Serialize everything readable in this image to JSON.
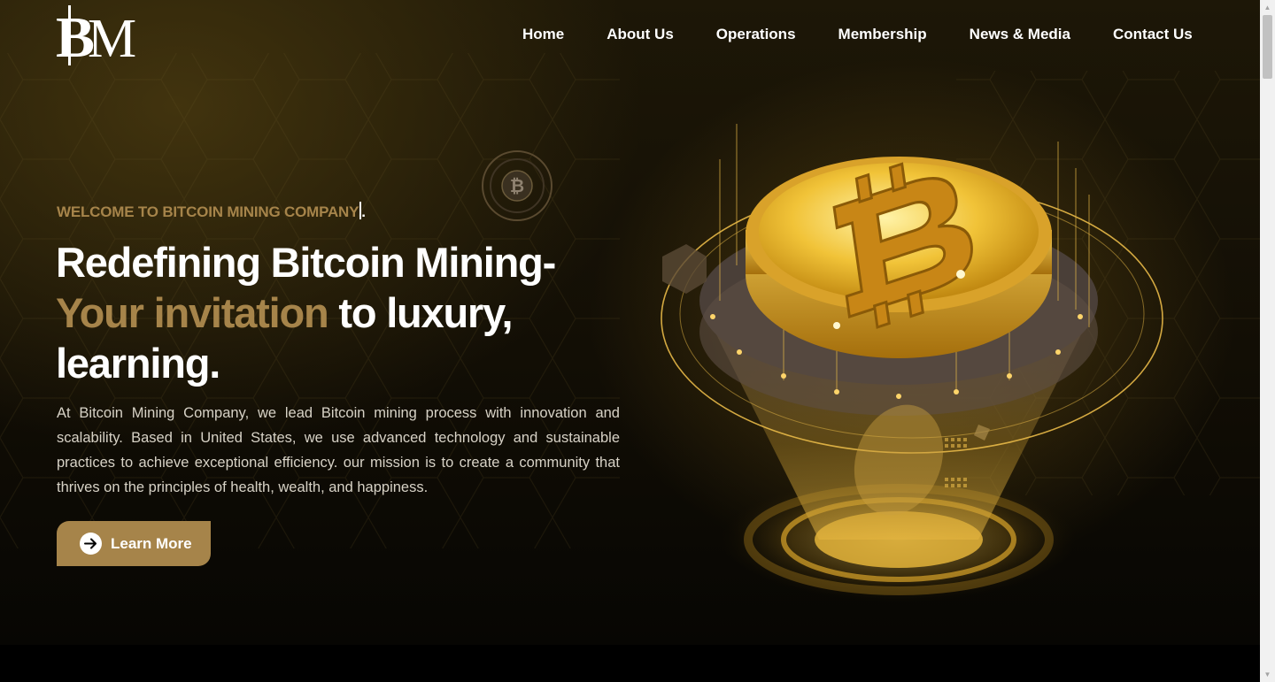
{
  "header": {
    "logo_text": "BM",
    "nav": [
      {
        "label": "Home"
      },
      {
        "label": "About Us"
      },
      {
        "label": "Operations"
      },
      {
        "label": "Membership"
      },
      {
        "label": "News & Media"
      },
      {
        "label": "Contact Us"
      }
    ]
  },
  "hero": {
    "welcome": "WELCOME TO BITCOIN MINING COMPANY",
    "welcome_suffix": ".",
    "headline_part1": "Redefining Bitcoin Mining-",
    "headline_gold": "Your invitation",
    "headline_part2": " to luxury, learning.",
    "description": "At Bitcoin Mining Company, we lead Bitcoin mining process with innovation and scalability. Based in United States, we use advanced technology and sustainable practices to achieve exceptional efficiency. our mission is to create a community that thrives on the principles of health, wealth, and happiness.",
    "cta_label": "Learn More",
    "cta_icon": "arrow-right-icon",
    "badge_icon": "bitcoin-icon",
    "illustration": "bitcoin-coin-funnel-illustration"
  },
  "colors": {
    "accent_gold": "#a6844a",
    "background": "#120e05",
    "text": "#ffffff"
  }
}
